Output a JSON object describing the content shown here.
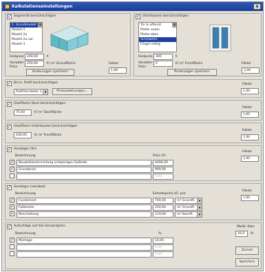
{
  "window": {
    "title": "Kalkulationseinstellungen",
    "close_label": "x"
  },
  "segments": {
    "checkbox_label": "Segmente berücksichtigen",
    "list": [
      "1. Grundmodell",
      "Modell 2",
      "Modell 2a",
      "Modell 2a var.",
      "Modell 3"
    ],
    "selected_index": 0,
    "price_label": "Festpreis",
    "price_value": "200,00",
    "price_unit": "€",
    "variable_label": "Variabler",
    "variable_label2": "Preis",
    "variable_value": "250,00",
    "variable_unit": "€/ m² Grundfläche",
    "factor_label": "Faktor",
    "factor_value": "1,00",
    "save_button": "Änderungen speichern"
  },
  "substructures": {
    "checkbox_label": "Unterbauten berücksichtigen",
    "list": [
      "Tür & offen/d",
      "Platte unten",
      "Platte oben",
      "Schiebetür",
      "Flügel mittig"
    ],
    "selected_index": 3,
    "price_label": "Festpreis",
    "price_value": "300",
    "price_unit": "€",
    "variable_label": "Variabler",
    "variable_label2": "Preis",
    "variable_value": "0",
    "variable_unit": "€/ m² Frontfläche",
    "factor_label": "Faktor",
    "factor_value": "1,00",
    "save_button": "Änderungen speichern"
  },
  "profile": {
    "checkbox_label": "Bd.m. Profil berücksichtigen",
    "select_value": "Profilhersteller 1",
    "price_button": "Preiszuweisungen...",
    "factor_label": "Faktor",
    "factor_value": "1,00"
  },
  "glass_roof": {
    "checkbox_label": "Glasfläche Dach berücksichtigen",
    "value": "75,00",
    "unit": "€/ m² Dachfläche",
    "factor_label": "Faktor",
    "factor_value": "1,00"
  },
  "glass_sub": {
    "checkbox_label": "Glasfläche Unterbauten berücksichtigen",
    "value": "160,00",
    "unit": "€/ m² Frontfläche",
    "factor_label": "Faktor",
    "factor_value": "1,00"
  },
  "misc_fixed": {
    "checkbox_label": "Sonstiges (fix)",
    "col_name": "Bezeichnung",
    "col_price": "Preis (€)",
    "factor_label": "Faktor",
    "factor_value": "1,00",
    "rows": [
      {
        "checked": true,
        "name": "Baustelleneinrichtung schwieriges Gelände",
        "price": "4000,00"
      },
      {
        "checked": true,
        "name": "Grundpreis",
        "price": "999,99"
      },
      {
        "checked": false,
        "name": "",
        "price": "0,00"
      }
    ]
  },
  "misc_variable": {
    "checkbox_label": "Sonstiges (variabel)",
    "col_name": "Bezeichnung",
    "col_price": "Einheitspreis (€)",
    "col_per": "pro",
    "factor_label": "Faktor",
    "factor_value": "1,00",
    "rows": [
      {
        "checked": true,
        "name": "Fundament",
        "price": "700,00",
        "unit": "m² Grundfl."
      },
      {
        "checked": true,
        "name": "Fußboden",
        "price": "250,00",
        "unit": "m² Grundfl."
      },
      {
        "checked": true,
        "name": "Beschattung",
        "price": "119,00",
        "unit": "m² Dachfl."
      }
    ]
  },
  "surcharges": {
    "checkbox_label": "Aufschläge auf den Gesamtpreis",
    "col_name": "Bezeichnung",
    "col_pct": "%",
    "vat_label": "MwSt.-Satz",
    "vat_value": "16,0",
    "vat_unit": "%",
    "rows": [
      {
        "checked": true,
        "name": "Montage",
        "pct": "10,00"
      },
      {
        "checked": false,
        "name": "",
        "pct": "0,00"
      },
      {
        "checked": false,
        "name": "",
        "pct": "0,00"
      }
    ]
  },
  "buttons": {
    "back": "Zurück",
    "save": "Speichern"
  },
  "colors": {
    "titlebar": "#1a3c97",
    "selection": "#1d3fa3",
    "dialog_bg": "#e4e0d8"
  }
}
